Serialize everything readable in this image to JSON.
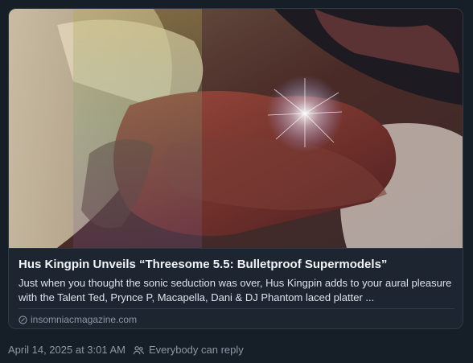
{
  "link_card": {
    "image_icon": "article-photo",
    "title": "Hus Kingpin Unveils “Threesome 5.5: Bulletproof Supermodels”",
    "description": "Just when you thought the sonic seduction was over, Hus Kingpin adds to your aural pleasure with the Talent Ted, Prynce P, Macapella, Dani & DJ Phantom laced platter ...",
    "domain_icon": "link-icon",
    "domain": "insomniacmagazine.com"
  },
  "post_meta": {
    "timestamp": "April 14, 2025 at 3:01 AM",
    "reply_icon": "people-icon",
    "reply_setting": "Everybody can reply"
  },
  "colors": {
    "background": "#161e27",
    "card_border": "#2f3a47",
    "text_primary": "#f1f4f7",
    "text_muted": "#8b98a5"
  }
}
